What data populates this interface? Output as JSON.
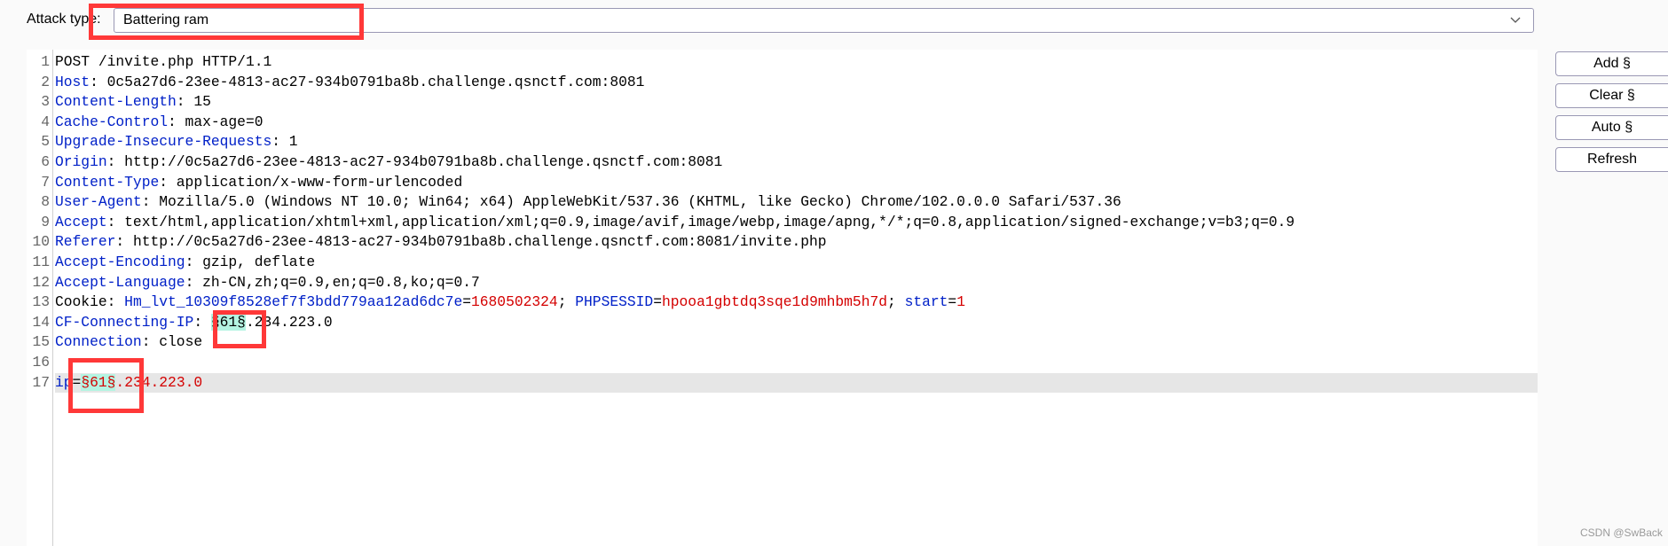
{
  "attack_type": {
    "label": "Attack type:",
    "value": "Battering ram",
    "dropdown_icon": "chevron-down-icon"
  },
  "colors": {
    "header_name": "#0020c8",
    "param_value": "#d40000",
    "payload_marker_bg": "#b4f4e2",
    "annotation_box": "#ff3838"
  },
  "editor": {
    "current_line": 17,
    "lines": [
      {
        "n": "1",
        "segs": [
          {
            "t": "plain",
            "v": "POST /invite.php HTTP/1.1"
          }
        ]
      },
      {
        "n": "2",
        "segs": [
          {
            "t": "name",
            "v": "Host"
          },
          {
            "t": "plain",
            "v": ": 0c5a27d6-23ee-4813-ac27-934b0791ba8b.challenge.qsnctf.com:8081"
          }
        ]
      },
      {
        "n": "3",
        "segs": [
          {
            "t": "name",
            "v": "Content-Length"
          },
          {
            "t": "plain",
            "v": ": 15"
          }
        ]
      },
      {
        "n": "4",
        "segs": [
          {
            "t": "name",
            "v": "Cache-Control"
          },
          {
            "t": "plain",
            "v": ": max-age=0"
          }
        ]
      },
      {
        "n": "5",
        "segs": [
          {
            "t": "name",
            "v": "Upgrade-Insecure-Requests"
          },
          {
            "t": "plain",
            "v": ": 1"
          }
        ]
      },
      {
        "n": "6",
        "segs": [
          {
            "t": "name",
            "v": "Origin"
          },
          {
            "t": "plain",
            "v": ": http://0c5a27d6-23ee-4813-ac27-934b0791ba8b.challenge.qsnctf.com:8081"
          }
        ]
      },
      {
        "n": "7",
        "segs": [
          {
            "t": "name",
            "v": "Content-Type"
          },
          {
            "t": "plain",
            "v": ": application/x-www-form-urlencoded"
          }
        ]
      },
      {
        "n": "8",
        "segs": [
          {
            "t": "name",
            "v": "User-Agent"
          },
          {
            "t": "plain",
            "v": ": Mozilla/5.0 (Windows NT 10.0; Win64; x64) AppleWebKit/537.36 (KHTML, like Gecko) Chrome/102.0.0.0 Safari/537.36"
          }
        ]
      },
      {
        "n": "9",
        "segs": [
          {
            "t": "name",
            "v": "Accept"
          },
          {
            "t": "plain",
            "v": ": text/html,application/xhtml+xml,application/xml;q=0.9,image/avif,image/webp,image/apng,*/*;q=0.8,application/signed-exchange;v=b3;q=0.9"
          }
        ]
      },
      {
        "n": "10",
        "segs": [
          {
            "t": "name",
            "v": "Referer"
          },
          {
            "t": "plain",
            "v": ": http://0c5a27d6-23ee-4813-ac27-934b0791ba8b.challenge.qsnctf.com:8081/invite.php"
          }
        ]
      },
      {
        "n": "11",
        "segs": [
          {
            "t": "name",
            "v": "Accept-Encoding"
          },
          {
            "t": "plain",
            "v": ": gzip, deflate"
          }
        ]
      },
      {
        "n": "12",
        "segs": [
          {
            "t": "name",
            "v": "Accept-Language"
          },
          {
            "t": "plain",
            "v": ": zh-CN,zh;q=0.9,en;q=0.8,ko;q=0.7"
          }
        ]
      },
      {
        "n": "13",
        "segs": [
          {
            "t": "plain",
            "v": "Cookie: "
          },
          {
            "t": "name",
            "v": "Hm_lvt_10309f8528ef7f3bdd779aa12ad6dc7e"
          },
          {
            "t": "plain",
            "v": "="
          },
          {
            "t": "pval",
            "v": "1680502324"
          },
          {
            "t": "plain",
            "v": "; "
          },
          {
            "t": "name",
            "v": "PHPSESSID"
          },
          {
            "t": "plain",
            "v": "="
          },
          {
            "t": "pval",
            "v": "hpooa1gbtdq3sqe1d9mhbm5h7d"
          },
          {
            "t": "plain",
            "v": "; "
          },
          {
            "t": "name",
            "v": "start"
          },
          {
            "t": "plain",
            "v": "="
          },
          {
            "t": "pval",
            "v": "1"
          }
        ]
      },
      {
        "n": "14",
        "segs": [
          {
            "t": "name",
            "v": "CF-Connecting-IP"
          },
          {
            "t": "plain",
            "v": ": "
          },
          {
            "t": "plain marker",
            "v": "§61§"
          },
          {
            "t": "plain",
            "v": ".234.223.0"
          }
        ]
      },
      {
        "n": "15",
        "segs": [
          {
            "t": "name",
            "v": "Connection"
          },
          {
            "t": "plain",
            "v": ": close"
          }
        ]
      },
      {
        "n": "16",
        "segs": []
      },
      {
        "n": "17",
        "segs": [
          {
            "t": "name",
            "v": "ip"
          },
          {
            "t": "plain",
            "v": "="
          },
          {
            "t": "pval marker",
            "v": "§61§"
          },
          {
            "t": "pval",
            "v": ".234.223.0"
          }
        ]
      }
    ]
  },
  "buttons": {
    "add": "Add §",
    "clear": "Clear §",
    "auto": "Auto §",
    "refresh": "Refresh"
  },
  "watermark": "CSDN @SwBack"
}
